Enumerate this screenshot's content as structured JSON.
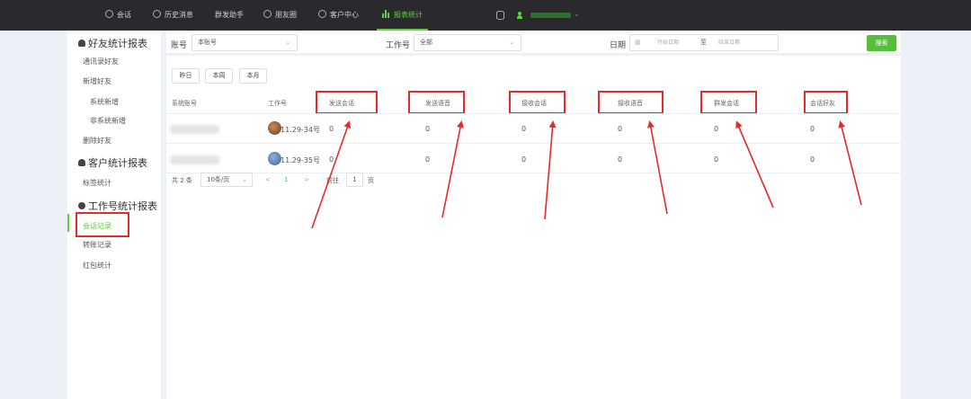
{
  "topnav": {
    "items": [
      {
        "label": "会话",
        "icon": "chat-icon"
      },
      {
        "label": "历史消息",
        "icon": "history-icon"
      },
      {
        "label": "群发助手",
        "icon": ""
      },
      {
        "label": "朋友圈",
        "icon": "moments-icon"
      },
      {
        "label": "客户中心",
        "icon": "customer-icon"
      },
      {
        "label": "报表统计",
        "icon": "chart-icon",
        "active": true
      }
    ]
  },
  "sidebar": {
    "groups": [
      {
        "title": "好友统计报表",
        "items": [
          "通讯录好友",
          "新增好友",
          "系统新增",
          "非系统新增",
          "删除好友"
        ]
      },
      {
        "title": "客户统计报表",
        "items": [
          "标签统计"
        ]
      },
      {
        "title": "工作号统计报表",
        "items": [
          "会话记录",
          "转账记录",
          "红包统计"
        ]
      }
    ],
    "active_item": "会话记录"
  },
  "filters": {
    "account_label": "账号",
    "account_value": "本账号",
    "workno_label": "工作号",
    "workno_value": "全部",
    "date_label": "日期",
    "date_start_placeholder": "开始日期",
    "date_sep": "至",
    "date_end_placeholder": "结束日期",
    "search_label": "搜索"
  },
  "quick": [
    "昨日",
    "本周",
    "本月"
  ],
  "table": {
    "headers": [
      "系统账号",
      "工作号",
      "发送会话",
      "发送语音",
      "接收会话",
      "接收语音",
      "群发会话",
      "会话好友"
    ],
    "rows": [
      {
        "workno": "11.29-34号",
        "values": [
          "0",
          "0",
          "0",
          "0",
          "0",
          "0"
        ]
      },
      {
        "workno": "11.29-35号",
        "values": [
          "0",
          "0",
          "0",
          "0",
          "0",
          "0"
        ]
      }
    ]
  },
  "pagination": {
    "total": "共 2 条",
    "page_size": "10条/页",
    "prev": "<",
    "current": "1",
    "next": ">",
    "goto_label": "前往",
    "goto_value": "1",
    "page_suffix": "页"
  },
  "colors": {
    "accent": "#5ad23a",
    "annotation": "#e62a2a",
    "topbar": "#2a2a2e"
  }
}
